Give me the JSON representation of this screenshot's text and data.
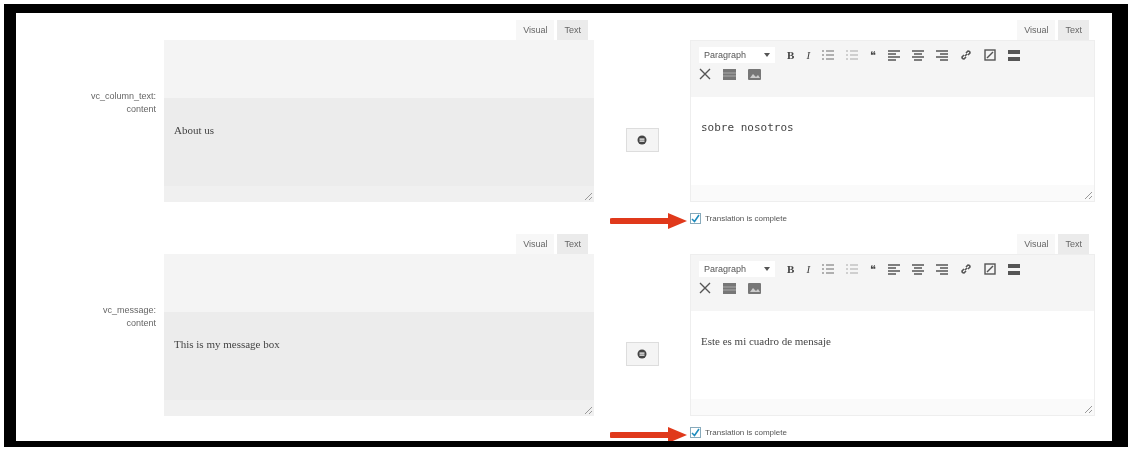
{
  "fields": [
    {
      "label": "vc_column_text: content",
      "source": {
        "tabs": [
          {
            "label": "Visual",
            "selected": false
          },
          {
            "label": "Text",
            "selected": true
          }
        ],
        "text": "About us"
      },
      "translation": {
        "tabs": [
          {
            "label": "Visual",
            "selected": false
          },
          {
            "label": "Text",
            "selected": true
          }
        ],
        "format_select": "Paragraph",
        "toolbar_glyphs": [
          "B",
          "I",
          "❝"
        ],
        "text": "sobre nosotros",
        "monospace": true,
        "complete_label": "Translation is complete",
        "complete": true
      }
    },
    {
      "label": "vc_message: content",
      "source": {
        "tabs": [
          {
            "label": "Visual",
            "selected": false
          },
          {
            "label": "Text",
            "selected": true
          }
        ],
        "text": "This is my message box"
      },
      "translation": {
        "tabs": [
          {
            "label": "Visual",
            "selected": false
          },
          {
            "label": "Text",
            "selected": true
          }
        ],
        "format_select": "Paragraph",
        "toolbar_glyphs": [
          "B",
          "I",
          "❝"
        ],
        "text": "Este es mi cuadro de mensaje",
        "monospace": false,
        "complete_label": "Translation is complete",
        "complete": true
      }
    }
  ]
}
